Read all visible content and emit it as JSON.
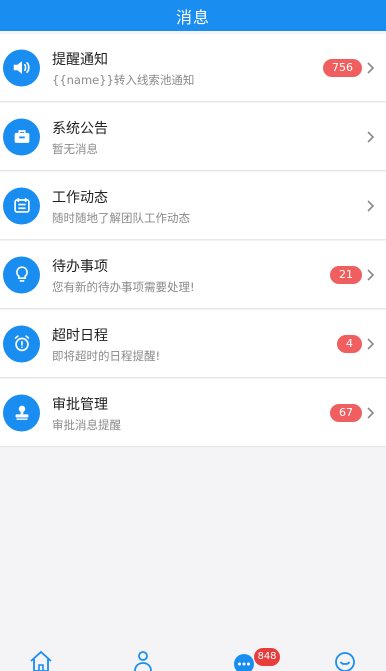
{
  "header": {
    "title": "消息"
  },
  "messages": [
    {
      "title": "提醒通知",
      "subtitle": "{{name}}转入线索池通知",
      "badge": "756",
      "icon": "speaker-icon"
    },
    {
      "title": "系统公告",
      "subtitle": "暂无消息",
      "badge": "",
      "icon": "briefcase-icon"
    },
    {
      "title": "工作动态",
      "subtitle": "随时随地了解团队工作动态",
      "badge": "",
      "icon": "calendar-icon"
    },
    {
      "title": "待办事项",
      "subtitle": "您有新的待办事项需要处理!",
      "badge": "21",
      "icon": "lightbulb-icon"
    },
    {
      "title": "超时日程",
      "subtitle": "即将超时的日程提醒!",
      "badge": "4",
      "icon": "alarm-clock-icon"
    },
    {
      "title": "审批管理",
      "subtitle": "审批消息提醒",
      "badge": "67",
      "icon": "stamp-icon"
    }
  ],
  "tabbar": {
    "message_badge": "848",
    "icons": [
      "home-icon",
      "contacts-icon",
      "messages-icon",
      "profile-icon"
    ]
  },
  "colors": {
    "primary": "#1a8ef0",
    "badge": "#ef5f5f",
    "tab_badge": "#e83d3d"
  }
}
